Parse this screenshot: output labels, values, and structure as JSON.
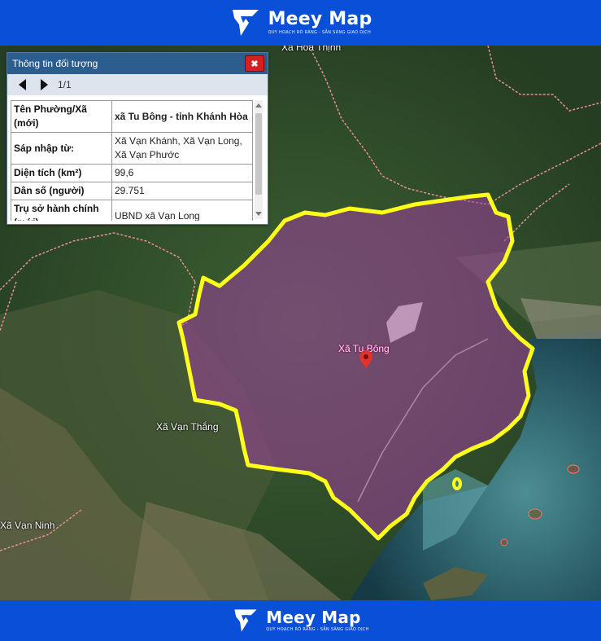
{
  "brand": {
    "name": "Meey Map",
    "tagline": "QUY HOẠCH RÕ RÀNG - SẴN SÀNG GIAO DỊCH",
    "color": "#0a4fd8"
  },
  "panel": {
    "title": "Thông tin đối tượng",
    "close_label": "✖",
    "page": "1/1",
    "rows": [
      {
        "key": "Tên Phường/Xã (mới)",
        "value": "xã Tu Bông - tỉnh Khánh Hòa"
      },
      {
        "key": "Sáp nhập từ:",
        "value": "Xã Vạn Khánh, Xã Vạn Long, Xã Vạn Phước"
      },
      {
        "key": "Diện tích (km²)",
        "value": "99,6"
      },
      {
        "key": "Dân số (người)",
        "value": "29.751"
      },
      {
        "key": "Trụ sở hành chính (mới)",
        "value": "UBND xã Vạn Long"
      }
    ]
  },
  "map": {
    "labels": {
      "hoa_thinh": "Xã Hòa Thịnh",
      "van_thang": "Xã Vạn Thắng",
      "van_ninh": "Xã Vạn Ninh",
      "tu_bong": "Xã Tu Bông"
    },
    "boundary_color": "#ffff1a",
    "fill_color": "#a040a0"
  }
}
